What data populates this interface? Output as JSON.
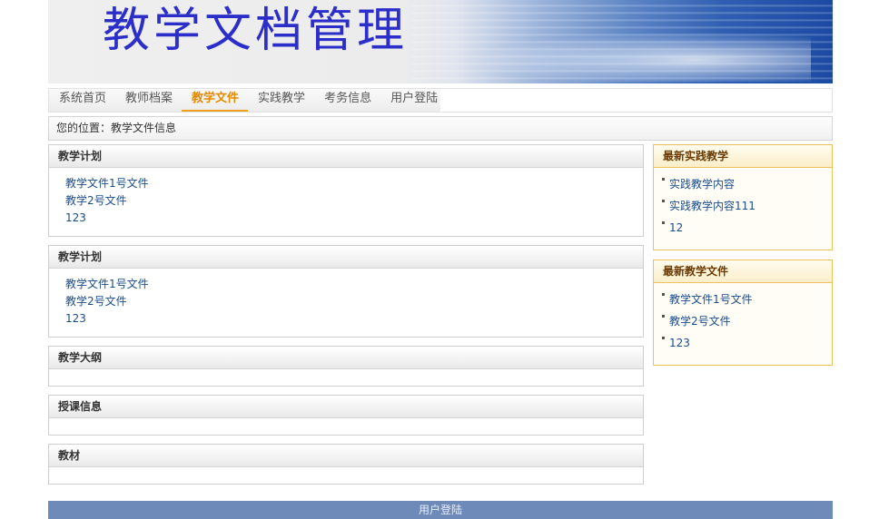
{
  "banner": {
    "title": "教学文档管理"
  },
  "nav": {
    "items": [
      {
        "label": "系统首页"
      },
      {
        "label": "教师档案"
      },
      {
        "label": "教学文件",
        "active": true
      },
      {
        "label": "实践教学"
      },
      {
        "label": "考务信息"
      },
      {
        "label": "用户登陆"
      }
    ]
  },
  "breadcrumb": {
    "text": "您的位置：教学文件信息"
  },
  "panels": [
    {
      "title": "教学计划",
      "links": [
        "教学文件1号文件",
        "教学2号文件",
        "123"
      ]
    },
    {
      "title": "教学计划",
      "links": [
        "教学文件1号文件",
        "教学2号文件",
        "123"
      ]
    },
    {
      "title": "教学大纲",
      "links": []
    },
    {
      "title": "授课信息",
      "links": []
    },
    {
      "title": "教材",
      "links": []
    }
  ],
  "side_boxes": [
    {
      "title": "最新实践教学",
      "links": [
        "实践教学内容",
        "实践教学内容111",
        "12"
      ]
    },
    {
      "title": "最新教学文件",
      "links": [
        "教学文件1号文件",
        "教学2号文件",
        "123"
      ]
    }
  ],
  "footer": {
    "text": "用户登陆"
  },
  "colors": {
    "active_nav": "#e68a00",
    "link": "#1b4d8a",
    "side_border": "#f0c060",
    "footer_bg": "#6d8ab9"
  }
}
